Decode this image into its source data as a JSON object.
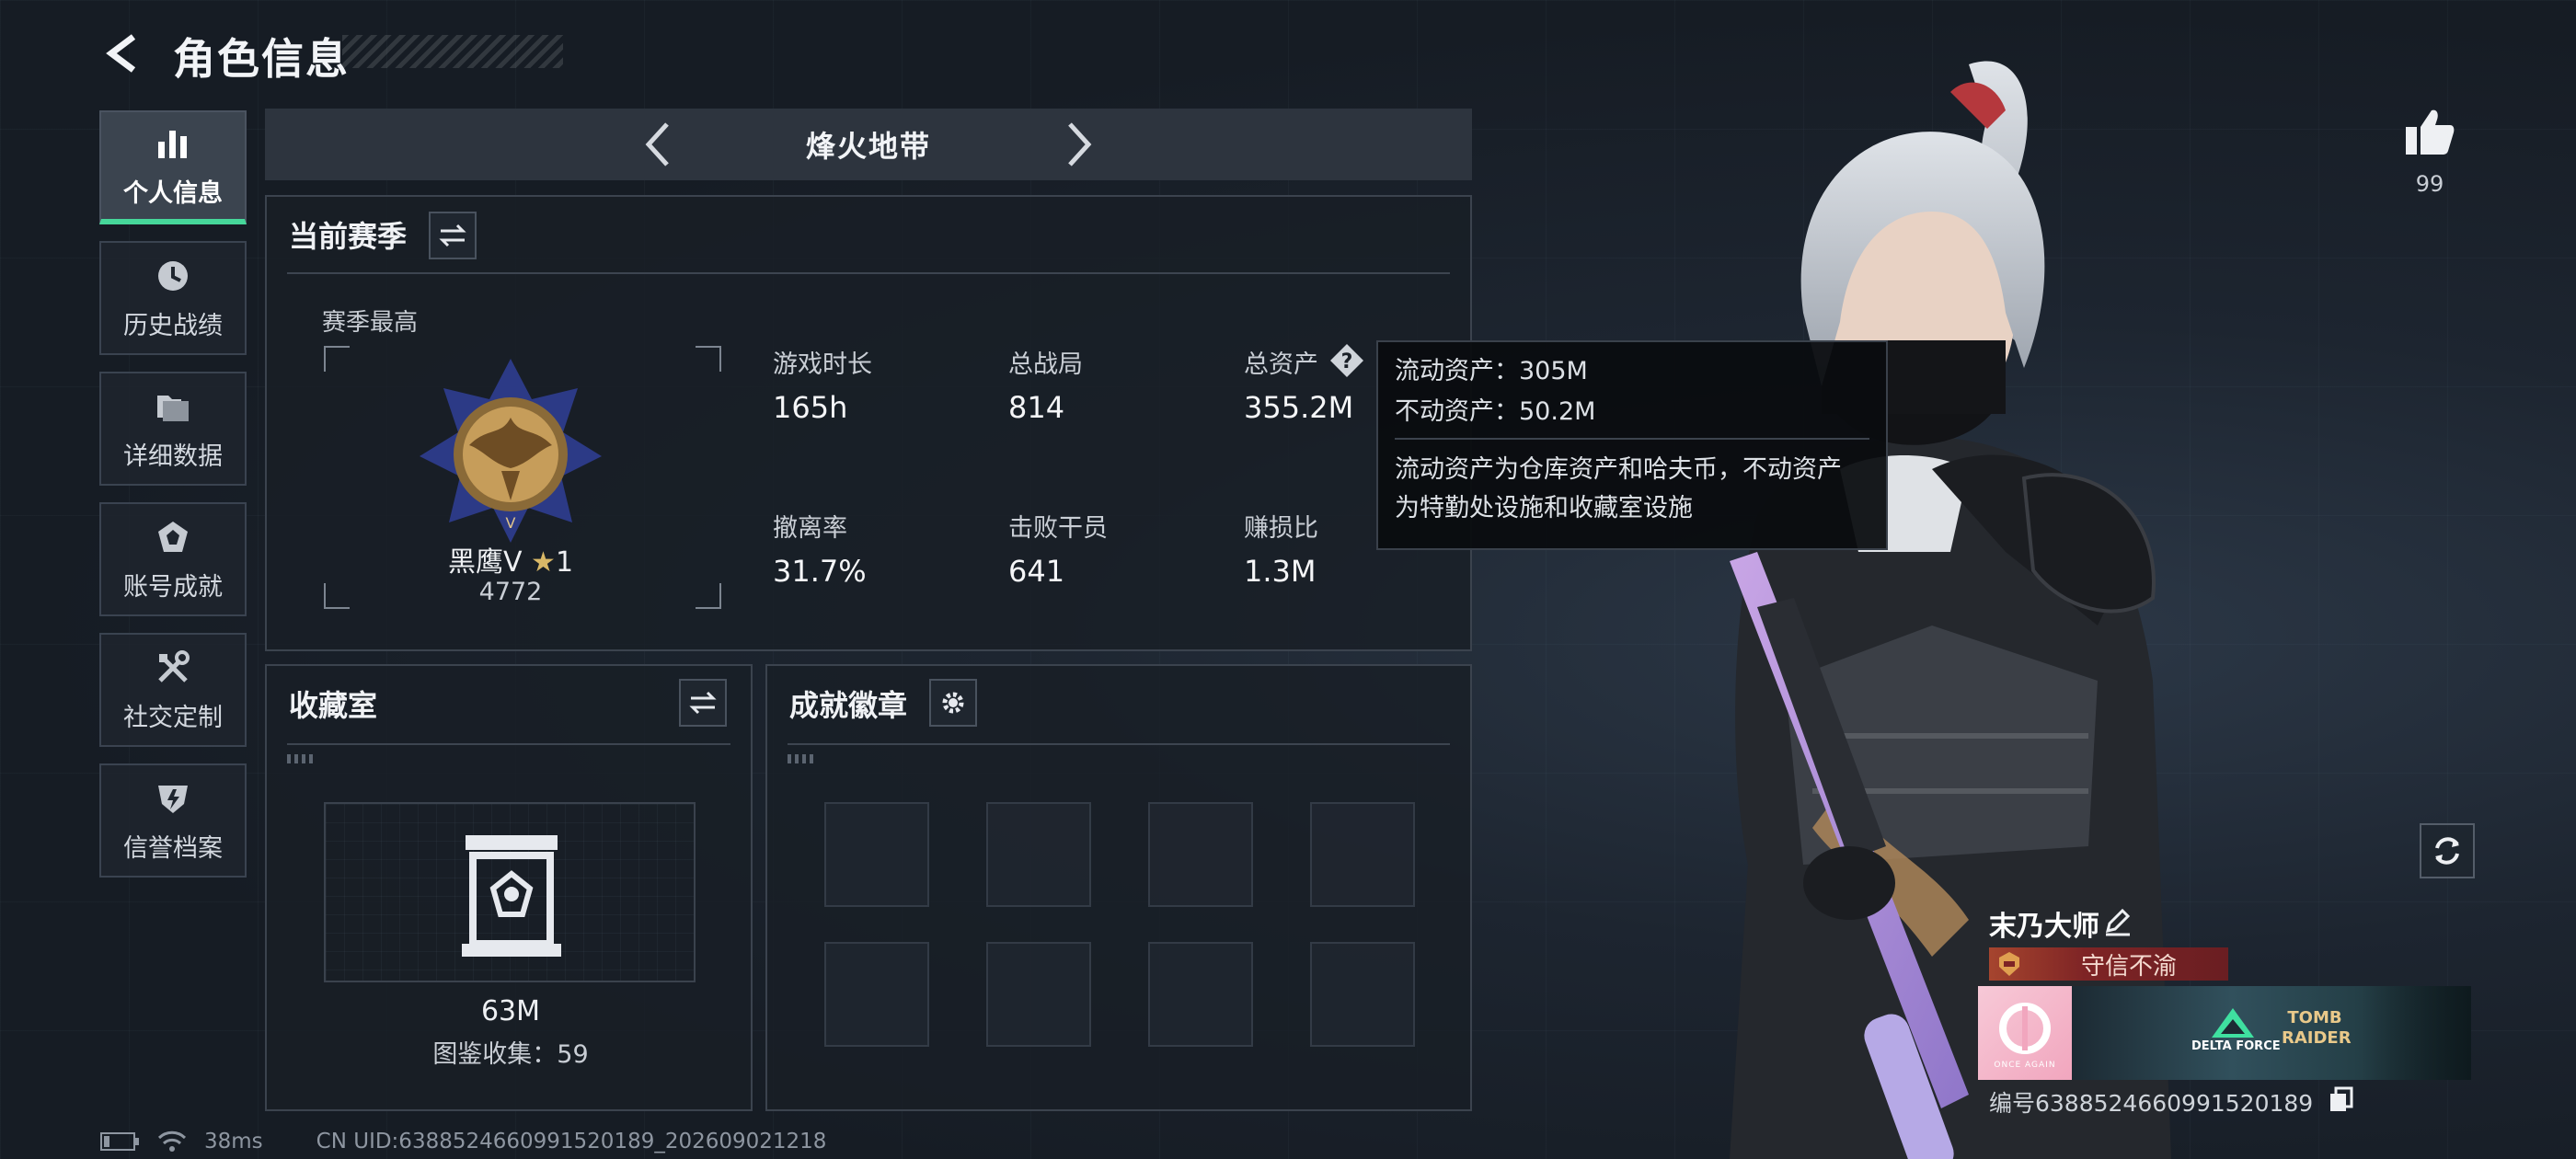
{
  "header": {
    "title": "角色信息"
  },
  "nav": {
    "items": [
      {
        "label": "个人信息",
        "icon": "bar-chart-icon",
        "active": true
      },
      {
        "label": "历史战绩",
        "icon": "clock-icon",
        "active": false
      },
      {
        "label": "详细数据",
        "icon": "folder-icon",
        "active": false
      },
      {
        "label": "账号成就",
        "icon": "medal-icon",
        "active": false
      },
      {
        "label": "社交定制",
        "icon": "tools-icon",
        "active": false
      },
      {
        "label": "信誉档案",
        "icon": "shield-icon",
        "active": false
      }
    ]
  },
  "mode": {
    "title": "烽火地带"
  },
  "season": {
    "header": "当前赛季",
    "best_label": "赛季最高",
    "rank_name": "黑鹰Ⅴ",
    "rank_star": "1",
    "rank_score": "4772",
    "stats": [
      {
        "label": "游戏时长",
        "value": "165h"
      },
      {
        "label": "总战局",
        "value": "814"
      },
      {
        "label": "总资产",
        "value": "355.2M"
      },
      {
        "label": "撤离率",
        "value": "31.7%"
      },
      {
        "label": "击败干员",
        "value": "641"
      },
      {
        "label": "赚损比",
        "value": "1.3M"
      }
    ]
  },
  "tooltip": {
    "liquid": "流动资产：305M",
    "fixed": "不动资产：50.2M",
    "description_line1": "流动资产为仓库资产和哈夫币，不动资产",
    "description_line2": "为特勤处设施和收藏室设施"
  },
  "collection": {
    "header": "收藏室",
    "value": "63M",
    "catalog": "图鉴收集：59"
  },
  "achievements": {
    "header": "成就徽章"
  },
  "likes": {
    "count": "99"
  },
  "player": {
    "name": "末乃大师",
    "honor": "守信不渝",
    "banner_logo_text": "ONCE AGAIN",
    "banner_brand": "DELTA FORCE",
    "banner_brand2": "TOMB RAIDER",
    "id_text": "编号6388524660991520189"
  },
  "status": {
    "ping": "38ms",
    "uid": "CN UID:6388524660991520189_202609021218"
  },
  "colors": {
    "accent_green": "#46d79a",
    "honor_red": "#7e2425",
    "panel_bg": "#181e26"
  }
}
